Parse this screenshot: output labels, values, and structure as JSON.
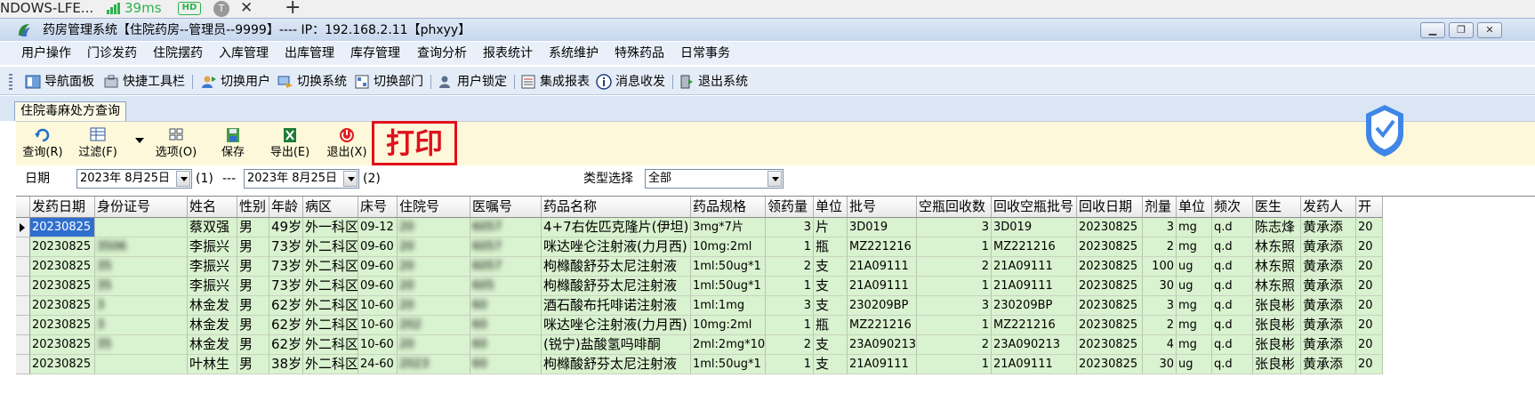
{
  "browser_tab": {
    "title": "NDOWS-LFE...",
    "ping": "39ms",
    "hd_badge": "HD",
    "avatar_letter": "T",
    "close_glyph": "✕",
    "add_glyph": "+"
  },
  "window": {
    "title": "药房管理系统【住院药房--管理员--9999】---- IP：192.168.2.11【phxyy】"
  },
  "menu": [
    "用户操作",
    "门诊发药",
    "住院摆药",
    "入库管理",
    "出库管理",
    "库存管理",
    "查询分析",
    "报表统计",
    "系统维护",
    "特殊药品",
    "日常事务"
  ],
  "toolbar": [
    "导航面板",
    "快捷工具栏",
    "切换用户",
    "切换系统",
    "切换部门",
    "用户锁定",
    "集成报表",
    "消息收发",
    "退出系统"
  ],
  "document_tab": "住院毒麻处方查询",
  "functions": {
    "query": "查询(R)",
    "filter": "过滤(F)",
    "options": "选项(O)",
    "save": "保存",
    "export": "导出(E)",
    "exit": "退出(X)",
    "print_annotation": "打印"
  },
  "filter": {
    "date_label": "日期",
    "start_date": "2023年  8月25日",
    "marker1": "(1)",
    "range_sep": "---",
    "end_date": "2023年  8月25日",
    "marker2": "(2)",
    "type_label": "类型选择",
    "type_value": "全部"
  },
  "grid": {
    "columns": [
      "发药日期",
      "身份证号",
      "姓名",
      "性别",
      "年龄",
      "病区",
      "床号",
      "住院号",
      "医嘱号",
      "药品名称",
      "药品规格",
      "领药量",
      "单位",
      "批号",
      "空瓶回收数",
      "回收空瓶批号",
      "回收日期",
      "剂量",
      "单位",
      "频次",
      "医生",
      "发药人",
      "开"
    ],
    "rows": [
      [
        "20230825",
        "",
        "蔡双强",
        "男",
        "49岁",
        "外一科区",
        "09-12",
        "20",
        "6057",
        "4+7右佐匹克隆片(伊坦)",
        "3mg*7片",
        "3",
        "片",
        "3D019",
        "3",
        "3D019",
        "20230825",
        "3",
        "mg",
        "q.d",
        "陈志烽",
        "黄承添",
        "20"
      ],
      [
        "20230825",
        "3506",
        "李振兴",
        "男",
        "73岁",
        "外二科区",
        "09-60",
        "20",
        "6057",
        "咪达唑仑注射液(力月西)",
        "10mg:2ml",
        "1",
        "瓶",
        "MZ221216",
        "1",
        "MZ221216",
        "20230825",
        "2",
        "mg",
        "q.d",
        "林东照",
        "黄承添",
        "20"
      ],
      [
        "20230825",
        "35",
        "李振兴",
        "男",
        "73岁",
        "外二科区",
        "09-60",
        "20",
        "6057",
        "枸橼酸舒芬太尼注射液",
        "1ml:50ug*1",
        "2",
        "支",
        "21A09111",
        "2",
        "21A09111",
        "20230825",
        "100",
        "ug",
        "q.d",
        "林东照",
        "黄承添",
        "20"
      ],
      [
        "20230825",
        "35",
        "李振兴",
        "男",
        "73岁",
        "外二科区",
        "09-60",
        "20",
        "605",
        "枸橼酸舒芬太尼注射液",
        "1ml:50ug*1",
        "1",
        "支",
        "21A09111",
        "1",
        "21A09111",
        "20230825",
        "30",
        "ug",
        "q.d",
        "林东照",
        "黄承添",
        "20"
      ],
      [
        "20230825",
        "3",
        "林金发",
        "男",
        "62岁",
        "外二科区",
        "10-60",
        "20",
        "60",
        "酒石酸布托啡诺注射液",
        "1ml:1mg",
        "3",
        "支",
        "230209BP",
        "3",
        "230209BP",
        "20230825",
        "3",
        "mg",
        "q.d",
        "张良彬",
        "黄承添",
        "20"
      ],
      [
        "20230825",
        "3",
        "林金发",
        "男",
        "62岁",
        "外二科区",
        "10-60",
        "202",
        "60",
        "咪达唑仑注射液(力月西)",
        "10mg:2ml",
        "1",
        "瓶",
        "MZ221216",
        "1",
        "MZ221216",
        "20230825",
        "2",
        "mg",
        "q.d",
        "张良彬",
        "黄承添",
        "20"
      ],
      [
        "20230825",
        "35",
        "林金发",
        "男",
        "62岁",
        "外二科区",
        "10-60",
        "20",
        "60",
        "(锐宁)盐酸氢吗啡酮",
        "2ml:2mg*10",
        "2",
        "支",
        "23A090213",
        "2",
        "23A090213",
        "20230825",
        "4",
        "mg",
        "q.d",
        "张良彬",
        "黄承添",
        "20"
      ],
      [
        "20230825",
        "",
        "叶林生",
        "男",
        "38岁",
        "外二科区",
        "24-60",
        "2023",
        "60",
        "枸橼酸舒芬太尼注射液",
        "1ml:50ug*1",
        "1",
        "支",
        "21A09111",
        "1",
        "21A09111",
        "20230825",
        "30",
        "ug",
        "q.d",
        "张良彬",
        "黄承添",
        "20"
      ]
    ]
  },
  "colors": {
    "row_bg": "#d9f2cf",
    "selected_bg": "#2f6fcf",
    "print_red": "#e0101b",
    "panel_bg": "#fdf8d9"
  }
}
